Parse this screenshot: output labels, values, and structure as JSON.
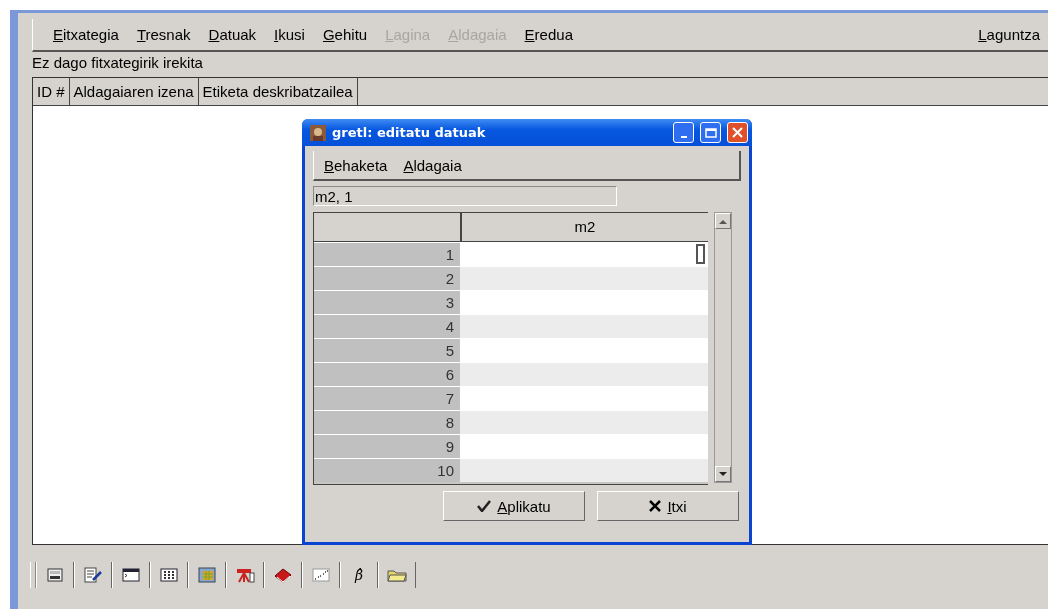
{
  "menu": [
    {
      "label": "Eitxategia",
      "disabled": false
    },
    {
      "label": "Tresnak",
      "disabled": false
    },
    {
      "label": "Datuak",
      "disabled": false
    },
    {
      "label": "Ikusi",
      "disabled": false
    },
    {
      "label": "Gehitu",
      "disabled": false
    },
    {
      "label": "Lagina",
      "disabled": true
    },
    {
      "label": "Aldagaia",
      "disabled": true
    },
    {
      "label": "Eredua",
      "disabled": false
    }
  ],
  "help_menu": {
    "label": "Laguntza"
  },
  "status": "Ez dago fitxategirik irekita",
  "table": {
    "columns": [
      "ID #",
      "Aldagaiaren izena",
      "Etiketa deskribatzailea"
    ]
  },
  "dialog": {
    "title": "gretl: editatu datuak",
    "menu": [
      "Behaketa",
      "Aldagaia"
    ],
    "cell_ref": "m2, 1",
    "column": "m2",
    "rows": [
      {
        "label": "1",
        "selected": true
      },
      {
        "label": "2",
        "selected": false
      },
      {
        "label": "3",
        "selected": false
      },
      {
        "label": "4",
        "selected": false
      },
      {
        "label": "5",
        "selected": false
      },
      {
        "label": "6",
        "selected": false
      },
      {
        "label": "7",
        "selected": false
      },
      {
        "label": "8",
        "selected": false
      },
      {
        "label": "9",
        "selected": false
      },
      {
        "label": "10",
        "selected": false
      }
    ],
    "buttons": [
      {
        "kind": "apply",
        "label": "Aplikatu"
      },
      {
        "kind": "close",
        "label": "Itxi"
      }
    ]
  },
  "toolbar": [
    {
      "kind": "calculator"
    },
    {
      "kind": "edit"
    },
    {
      "kind": "console"
    },
    {
      "kind": "keypad"
    },
    {
      "kind": "spreadsheet"
    },
    {
      "kind": "easel"
    },
    {
      "kind": "book"
    },
    {
      "kind": "scatter"
    },
    {
      "kind": "beta",
      "label": "β̂"
    },
    {
      "kind": "folder"
    }
  ]
}
